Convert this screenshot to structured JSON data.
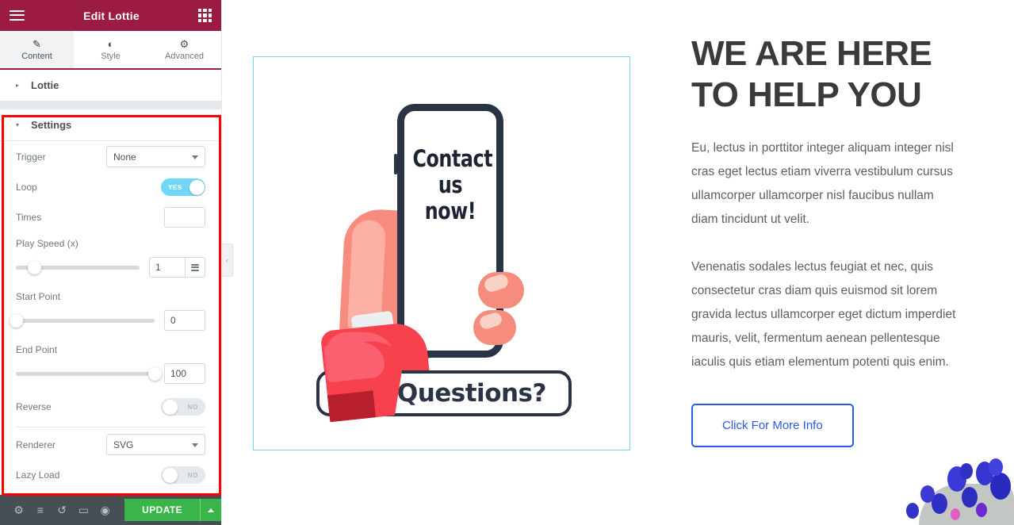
{
  "panel": {
    "header": {
      "title": "Edit Lottie",
      "menu_icon": "hamburger-icon",
      "widgets_icon": "grid-icon"
    },
    "tabs": [
      {
        "label": "Content",
        "icon": "pencil-icon",
        "glyph": "✎",
        "active": true
      },
      {
        "label": "Style",
        "icon": "contrast-icon",
        "glyph": "◐",
        "active": false
      },
      {
        "label": "Advanced",
        "icon": "gear-icon",
        "glyph": "⚙",
        "active": false
      }
    ],
    "sections": [
      {
        "title": "Lottie",
        "expanded": false,
        "caret": "▸"
      },
      {
        "title": "Settings",
        "expanded": true,
        "caret": "▾"
      }
    ],
    "settings": {
      "trigger": {
        "label": "Trigger",
        "value": "None"
      },
      "loop": {
        "label": "Loop",
        "state": "YES",
        "on": true
      },
      "times": {
        "label": "Times",
        "value": ""
      },
      "play_speed": {
        "label": "Play Speed (x)",
        "value": "1",
        "slider_percent": 15
      },
      "start_point": {
        "label": "Start Point",
        "value": "0",
        "slider_percent": 0
      },
      "end_point": {
        "label": "End Point",
        "value": "100",
        "slider_percent": 100
      },
      "reverse": {
        "label": "Reverse",
        "state": "NO",
        "on": false
      },
      "renderer": {
        "label": "Renderer",
        "value": "SVG"
      },
      "lazy_load": {
        "label": "Lazy Load",
        "state": "NO",
        "on": false
      }
    },
    "footer": {
      "icons": [
        {
          "name": "settings-gear-icon",
          "glyph": "⚙"
        },
        {
          "name": "navigator-layers-icon",
          "glyph": "≡"
        },
        {
          "name": "history-revisions-icon",
          "glyph": "↺"
        },
        {
          "name": "responsive-mode-icon",
          "glyph": "▭"
        },
        {
          "name": "preview-eye-icon",
          "glyph": "◉"
        }
      ],
      "update_label": "UPDATE"
    },
    "collapse_handle": "‹",
    "annotation_color": "#FF0000"
  },
  "canvas": {
    "widget_border_color": "#71D7F7",
    "lottie": {
      "phone_text": "Contact\nus\nnow!",
      "phone_line1": "Contact",
      "phone_line2": "us",
      "phone_line3": "now!",
      "banner_text": "Questions?"
    },
    "content": {
      "headline_line1": "WE ARE HERE",
      "headline_line2": "TO HELP YOU",
      "paragraph1": "Eu, lectus in porttitor integer aliquam integer nisl cras eget lectus etiam viverra vestibulum cursus ullamcorper ullamcorper nisl faucibus nullam diam tincidunt ut velit.",
      "paragraph2": "Venenatis sodales lectus feugiat et nec, quis consectetur cras diam quis euismod sit lorem gravida lectus ullamcorper eget dictum imperdiet mauris, velit, fermentum aenean pellentesque iaculis quis etiam elementum potenti quis enim.",
      "cta_label": "Click For More Info",
      "cta_color": "#2B59E8"
    }
  },
  "colors": {
    "header_bg": "#9B1B42",
    "toggle_on": "#71D7F7",
    "update_green": "#39B54A",
    "footer_bg": "#474F54"
  }
}
